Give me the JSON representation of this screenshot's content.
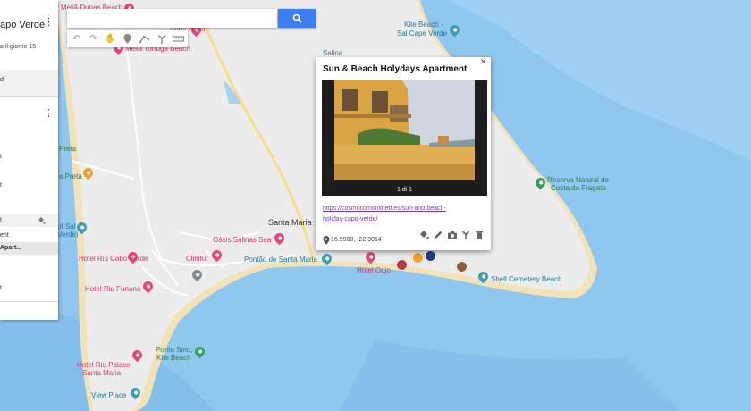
{
  "colors": {
    "water": "#8fc7ef",
    "land": "#ececec",
    "road": "#ffffff",
    "highway": "#f6df84",
    "sand": "#f2e3b6",
    "accent": "#3d7ef0",
    "link": "#6f3fb2"
  },
  "sidebar": {
    "title": "apo Verde",
    "subtitle": "a il giorno 15",
    "items": [
      {
        "label": "di"
      },
      {
        "label": "t"
      },
      {
        "label": "t"
      },
      {
        "label": "t"
      },
      {
        "label": "ent"
      },
      {
        "label": "Apart..."
      },
      {
        "label": "t"
      }
    ]
  },
  "search": {
    "placeholder": "",
    "button_icon": "search-icon"
  },
  "toolbar": {
    "icons": [
      "undo-icon",
      "redo-icon",
      "hand-icon",
      "add-marker-icon",
      "draw-line-icon",
      "directions-icon",
      "ruler-icon"
    ]
  },
  "popup": {
    "title": "Sun & Beach Holydays Apartment",
    "photo_counter": "1 di 1",
    "link_line1": "https://cosmocomonlinetf.es/sun-and-beach-",
    "link_line2": "holiday-capo-verde/",
    "coords": "16.5960, -22.9014",
    "action_icons": [
      "paint-bucket-icon",
      "edit-icon",
      "camera-icon",
      "directions-icon",
      "delete-icon"
    ]
  },
  "map_labels": {
    "melia_dunas": "Meliã Dunas Beach",
    "aqua_hotel": "Aqua Hotel",
    "melia_tortuga": "Meliã Tortuga Beach",
    "kite_beach_sal": "Kite Beach -",
    "kite_beach_sal2": "Sal Cape Verde",
    "salinas": "Salina",
    "preta": "Preta",
    "preta2": "a Preta",
    "of_sal": "of Sal",
    "verde": "Verde)",
    "santa_maria": "Santa Maria",
    "oasis": "Oásis Salinas Sea",
    "clinitur": "Clinitur",
    "pontao": "Pontão de Santa Maria",
    "hotel_odjo": "Hotel Odjo",
    "riu_cabo_verde": "Hotel Riu Cabo Verde",
    "riu_funana": "Hotel Riu Funana",
    "reserva1": "Reserva Natural de",
    "reserva2": "Costa da Fragata",
    "shell_cemetery": "Shell Cemetery Beach",
    "ponta_sino1": "Ponta Sino,",
    "ponta_sino2": "Kite Beach",
    "riu_palace1": "Hotel Riu Palace",
    "riu_palace2": "Santa Maria",
    "view_place": "View Place"
  }
}
